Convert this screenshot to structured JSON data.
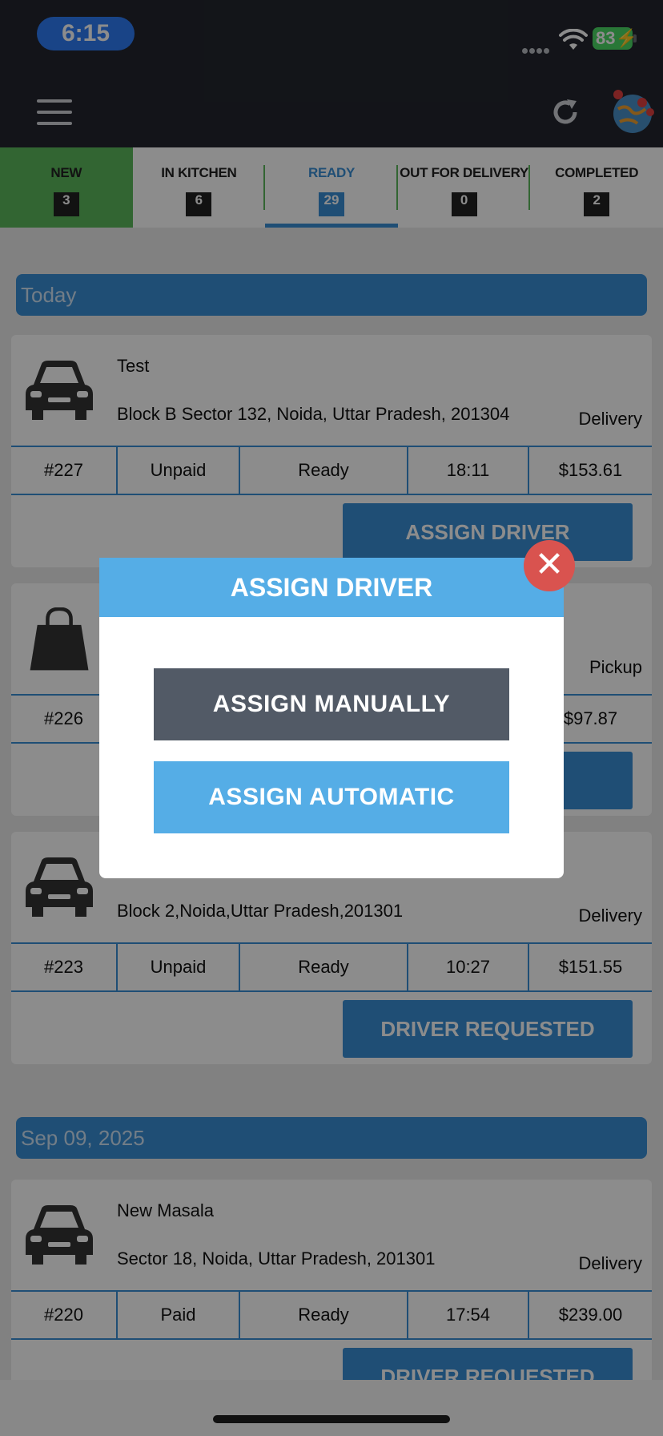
{
  "status_bar": {
    "time": "6:15",
    "battery": "83"
  },
  "header": {
    "menu_icon": "hamburger-icon",
    "refresh_icon": "refresh-icon",
    "map_icon": "globe-map-icon"
  },
  "tabs": [
    {
      "label": "NEW",
      "count": "3"
    },
    {
      "label": "IN KITCHEN",
      "count": "6"
    },
    {
      "label": "READY",
      "count": "29",
      "active": true
    },
    {
      "label": "OUT FOR DELIVERY",
      "count": "0"
    },
    {
      "label": "COMPLETED",
      "count": "2"
    }
  ],
  "sections": [
    {
      "title": "Today"
    },
    {
      "title": "Sep 09, 2025"
    }
  ],
  "orders": [
    {
      "icon": "car-icon",
      "name": "Test",
      "address": "Block B Sector 132, Noida, Uttar Pradesh, 201304",
      "type": "Delivery",
      "id": "#227",
      "payment": "Unpaid",
      "status": "Ready",
      "time": "18:11",
      "amount": "$153.61",
      "action": "ASSIGN DRIVER"
    },
    {
      "icon": "shopping-bag-icon",
      "name": "",
      "address": "",
      "type": "Pickup",
      "id": "#226",
      "payment": "",
      "status": "",
      "time": "",
      "amount": "$97.87",
      "action": ""
    },
    {
      "icon": "car-icon",
      "name": "",
      "address": "Block 2,Noida,Uttar Pradesh,201301",
      "type": "Delivery",
      "id": "#223",
      "payment": "Unpaid",
      "status": "Ready",
      "time": "10:27",
      "amount": "$151.55",
      "action": "DRIVER REQUESTED"
    },
    {
      "icon": "car-icon",
      "name": "New Masala",
      "address": "Sector 18, Noida, Uttar Pradesh, 201301",
      "type": "Delivery",
      "id": "#220",
      "payment": "Paid",
      "status": "Ready",
      "time": "17:54",
      "amount": "$239.00",
      "action": "DRIVER REQUESTED"
    }
  ],
  "modal": {
    "title": "ASSIGN DRIVER",
    "manual_label": "ASSIGN MANUALLY",
    "automatic_label": "ASSIGN AUTOMATIC",
    "close_icon": "close-icon",
    "close_glyph": "✕"
  },
  "colors": {
    "accent": "#3a8fd6",
    "modal_accent": "#55ade6",
    "new_tab": "#5cb85c",
    "close": "#d9534f",
    "dark_header": "#23262e"
  }
}
